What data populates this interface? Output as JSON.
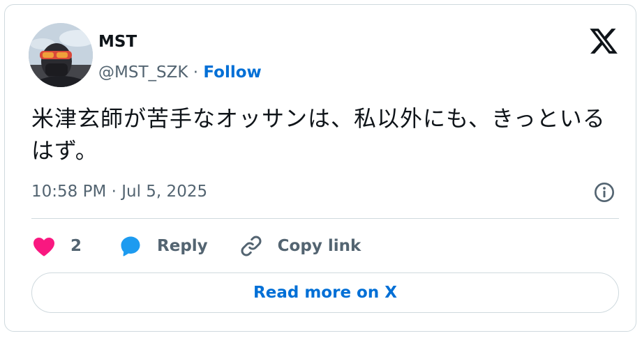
{
  "author": {
    "name": "MST",
    "handle": "@MST_SZK",
    "separator": "·",
    "follow_label": "Follow"
  },
  "tweet": {
    "text": "米津玄師が苦手なオッサンは、私以外にも、きっといるはず。",
    "timestamp": "10:58 PM · Jul 5, 2025"
  },
  "actions": {
    "like_count": "2",
    "reply_label": "Reply",
    "copy_link_label": "Copy link"
  },
  "read_more_label": "Read more on X",
  "colors": {
    "accent": "#006fd6",
    "like": "#f91880",
    "reply": "#1d9bf0",
    "secondary_text": "#536471",
    "border": "#cfd9de"
  },
  "icons": [
    "x-logo-icon",
    "info-icon",
    "heart-icon",
    "reply-bubble-icon",
    "link-icon"
  ]
}
